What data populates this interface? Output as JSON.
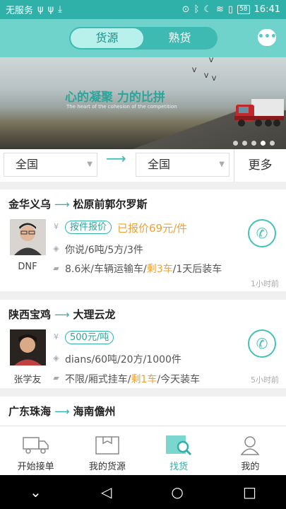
{
  "status_bar": {
    "carrier": "无服务",
    "battery": "58",
    "time": "16:41"
  },
  "header": {
    "tabs": [
      {
        "label": "货源"
      },
      {
        "label": "熟货"
      }
    ],
    "chat_icon": "chat-bubble-icon"
  },
  "banner": {
    "title": "心的凝聚 力的比拼",
    "subtitle": "The heart of the cohesion of the competition",
    "page_count": 5,
    "active_page": 4
  },
  "filter": {
    "from": "全国",
    "to": "全国",
    "more": "更多"
  },
  "listings": [
    {
      "from": "金华义乌",
      "to": "松原前郭尔罗斯",
      "user": "DNF",
      "price_tag": "按件报价",
      "price_text": "已报价69元/件",
      "cargo": "你说/6吨/5方/3件",
      "vehicle_prefix": "8.6米/车辆运输车/",
      "vehicle_highlight": "剩3车",
      "vehicle_suffix": "/1天后装车",
      "time": "1小时前"
    },
    {
      "from": "陕西宝鸡",
      "to": "大理云龙",
      "user": "张学友",
      "price_tag": "500元/吨",
      "price_text": "",
      "cargo": "dians/60吨/20方/1000件",
      "vehicle_prefix": "不限/厢式挂车/",
      "vehicle_highlight": "剩1车",
      "vehicle_suffix": "/今天装车",
      "time": "5小时前"
    },
    {
      "from": "广东珠海",
      "to": "海南儋州"
    }
  ],
  "tabbar": [
    {
      "label": "开始接单",
      "icon": "truck-icon"
    },
    {
      "label": "我的货源",
      "icon": "box-icon"
    },
    {
      "label": "找货",
      "icon": "search-cargo-icon"
    },
    {
      "label": "我的",
      "icon": "person-icon"
    }
  ],
  "colors": {
    "accent": "#2fb0a8",
    "highlight": "#f0a030"
  }
}
